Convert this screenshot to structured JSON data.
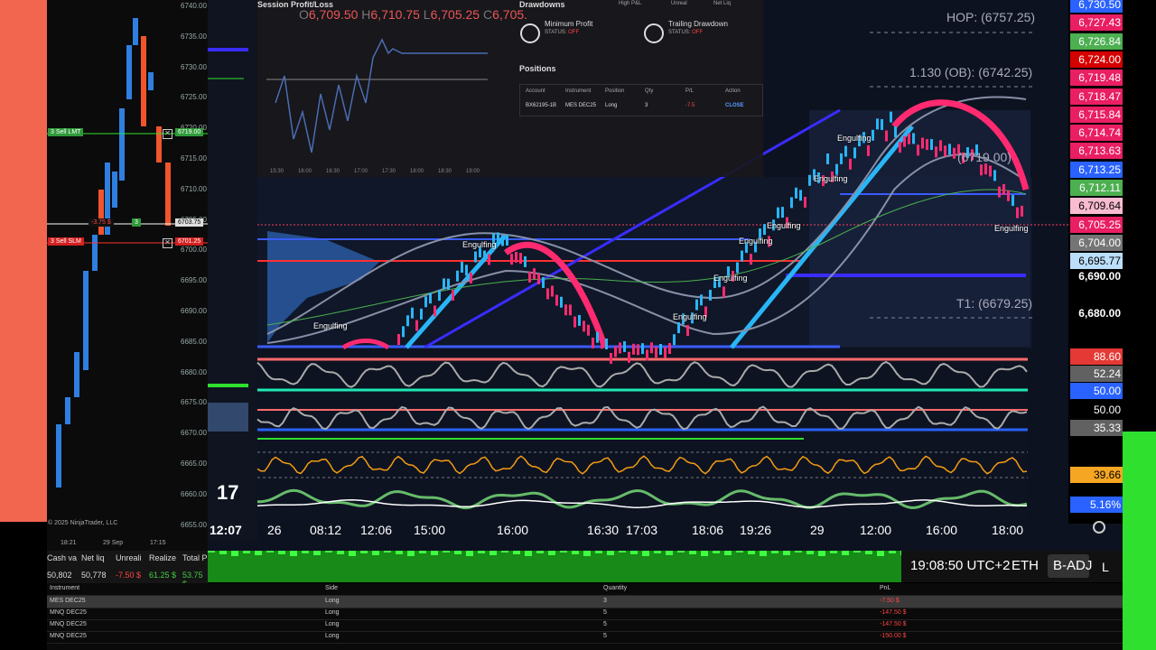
{
  "nt": {
    "yaxis": [
      "6740.00",
      "6735.00",
      "6730.00",
      "6725.00",
      "6720.00",
      "6715.00",
      "6710.00",
      "6705.00",
      "6700.00",
      "6695.00",
      "6690.00",
      "6685.00",
      "6680.00",
      "6675.00",
      "6670.00",
      "6665.00",
      "6660.00",
      "6655.00"
    ],
    "xaxis": [
      "18:21",
      "29 Sep",
      "17:15"
    ],
    "copyright": "© 2025 NinjaTrader, LLC",
    "sell_lmt": "3 Sell LMT",
    "sell_lmt_price": "6719.00",
    "sell_slm": "3 Sell SLM",
    "sell_slm_price": "6701.25",
    "pos_pnl": "-3.75 $",
    "pos_qty": "3",
    "last_price": "6703.75",
    "colors": {
      "buy": "#2f7fe0",
      "sell": "#f2552c"
    }
  },
  "account": {
    "headers": [
      "Cash va",
      "Net liq",
      "Unreali",
      "Realize",
      "Total P"
    ],
    "values": [
      "50,802",
      "50,778",
      "-7.50 $",
      "61.25 $",
      "53.75 $"
    ]
  },
  "positions_table": {
    "headers": [
      "Instrument",
      "Side",
      "Quantity",
      "PnL"
    ],
    "rows": [
      {
        "instrument": "MES DEC25",
        "side": "Long",
        "qty": "3",
        "pnl": "-7.50 $"
      },
      {
        "instrument": "MNQ DEC25",
        "side": "Long",
        "qty": "5",
        "pnl": "-147.50 $"
      },
      {
        "instrument": "MNQ DEC25",
        "side": "Long",
        "qty": "5",
        "pnl": "-147.50 $"
      },
      {
        "instrument": "MNQ DEC25",
        "side": "Long",
        "qty": "5",
        "pnl": "-150.00 $"
      }
    ]
  },
  "overlay": {
    "session_title": "Session Profit/Loss",
    "ohlc": {
      "o_label": "O",
      "o": "6,709.50",
      "h_label": "H",
      "h": "6,710.75",
      "l_label": "L",
      "l": "6,705.25",
      "c_label": "C",
      "c": "6,705."
    },
    "session_x": [
      "15:30",
      "16:00",
      "16:30",
      "17:00",
      "17:30",
      "18:00",
      "18:30",
      "19:00"
    ],
    "drawdowns_title": "Drawdowns",
    "min_profit": "Minimum Profit",
    "trailing": "Trailing Drawdown",
    "status_label": "STATUS:",
    "status_value": "OFF",
    "top_labels": [
      "High P&L",
      "Unreal",
      "Net Liq"
    ],
    "positions_title": "Positions",
    "pos_headers": [
      "Account",
      "Instrument",
      "Position",
      "Qty",
      "P/L",
      "Action"
    ],
    "pos_row": {
      "account": "BX62195-1B",
      "instrument": "MES DEC25",
      "position": "Long",
      "qty": "3",
      "pl": "-7.5",
      "action": "CLOSE"
    }
  },
  "levels": {
    "hop": "HOP: (6757.25)",
    "ob": "1.130 (OB): (6742.25)",
    "mid": "(6719.00)",
    "t1": "T1: (6679.25)"
  },
  "chart_labels": [
    "Engulfing",
    "Engulfing",
    "Engulfing",
    "Engulfing",
    "Engulfing",
    "Engulfing",
    "Engulfing",
    "Engulfing",
    "Engulfing"
  ],
  "price_axis": [
    {
      "v": "6,730.50",
      "bg": "#2962ff"
    },
    {
      "v": "6,727.43",
      "bg": "#e91e63"
    },
    {
      "v": "6,726.84",
      "bg": "#4caf50"
    },
    {
      "v": "6,724.00",
      "bg": "#d50000"
    },
    {
      "v": "6,719.48",
      "bg": "#e91e63"
    },
    {
      "v": "6,718.47",
      "bg": "#e91e63"
    },
    {
      "v": "6,715.84",
      "bg": "#e91e63"
    },
    {
      "v": "6,714.74",
      "bg": "#e91e63"
    },
    {
      "v": "6,713.63",
      "bg": "#e91e63"
    },
    {
      "v": "6,713.25",
      "bg": "#2962ff"
    },
    {
      "v": "6,712.11",
      "bg": "#4caf50"
    },
    {
      "v": "6,709.64",
      "bg": "#f8bbd0"
    },
    {
      "v": "6,705.25",
      "bg": "#e91e63"
    },
    {
      "v": "6,704.00",
      "bg": "#757575"
    },
    {
      "v": "6,695.77",
      "bg": "#bbdefb"
    }
  ],
  "price_plain": [
    "6,690.00",
    "6,680.00"
  ],
  "indicator_axis": [
    {
      "v": "88.60",
      "bg": "#e53935"
    },
    {
      "v": "52.24",
      "bg": "#616161"
    },
    {
      "v": "50.00",
      "bg": "#2962ff"
    },
    {
      "v": "50.00",
      "bg": "#000000"
    },
    {
      "v": "35.33",
      "bg": "#616161"
    },
    {
      "v": "39.66",
      "bg": "#f5a623"
    },
    {
      "v": "5.16%",
      "bg": "#2962ff"
    }
  ],
  "time_axis": [
    "12:07",
    "26",
    "08:12",
    "12:06",
    "15:00",
    "16:00",
    "16:30",
    "17:03",
    "18:06",
    "19:26",
    "29",
    "12:00",
    "16:00",
    "18:00"
  ],
  "status": {
    "clock": "19:08:50 UTC+2",
    "exch": "ETH",
    "adj": "B-ADJ",
    "l": "L"
  }
}
